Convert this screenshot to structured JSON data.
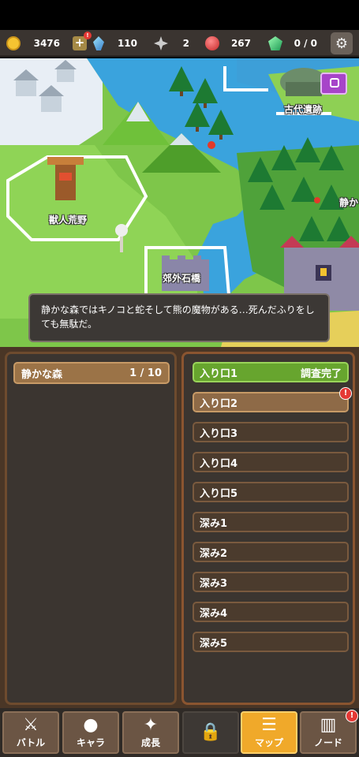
{
  "resources": {
    "gold": "3476",
    "crystal": "110",
    "shard": "2",
    "ruby": "267",
    "emerald": "0 / 0",
    "plus_badge": "!"
  },
  "map": {
    "labels": {
      "beast_wasteland": "獣人荒野",
      "suburb_bridge": "郊外石橋",
      "ancient_ruins": "古代遺跡",
      "quiet_partial": "静か"
    },
    "tooltip": "静かな森ではキノコと蛇そして熊の魔物がある…死んだふりをしても無駄だ。"
  },
  "area": {
    "name": "静かな森",
    "progress": "1 / 10"
  },
  "entries": [
    {
      "label": "入り口1",
      "status": "調査完了"
    },
    {
      "label": "入り口2",
      "badge": "!"
    },
    {
      "label": "入り口3"
    },
    {
      "label": "入り口4"
    },
    {
      "label": "入り口5"
    },
    {
      "label": "深み1"
    },
    {
      "label": "深み2"
    },
    {
      "label": "深み3"
    },
    {
      "label": "深み4"
    },
    {
      "label": "深み5"
    }
  ],
  "nav": {
    "battle": "バトル",
    "chara": "キャラ",
    "growth": "成長",
    "map": "マップ",
    "node": "ノード",
    "node_badge": "!"
  },
  "colors": {
    "done": "#67a52e",
    "active": "#8e6a47",
    "current_tab": "#f0a92a"
  }
}
